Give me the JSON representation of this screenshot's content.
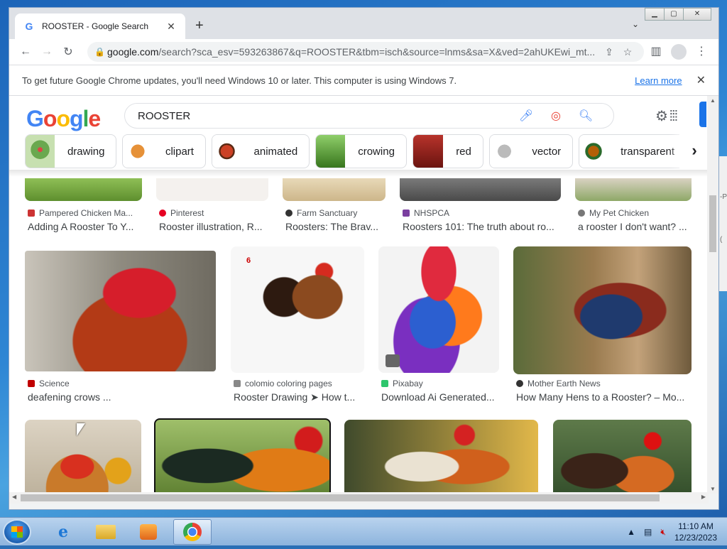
{
  "window": {
    "tab_title": "ROOSTER - Google Search",
    "new_tab": "+",
    "controls": {
      "minimize": "▁",
      "maximize": "▢",
      "close": "✕"
    }
  },
  "toolbar": {
    "url_host": "google.com",
    "url_path": "/search?sca_esv=593263867&q=ROOSTER&tbm=isch&source=lnms&sa=X&ved=2ahUKEwi_mt..."
  },
  "infobar": {
    "message": "To get future Google Chrome updates, you'll need Windows 10 or later. This computer is using Windows 7.",
    "link": "Learn more"
  },
  "google": {
    "logo": [
      "G",
      "o",
      "o",
      "g",
      "l",
      "e"
    ],
    "query": "ROOSTER"
  },
  "chips": [
    {
      "label": "drawing",
      "color": "#6aa84f"
    },
    {
      "label": "clipart",
      "color": "#e69138"
    },
    {
      "label": "animated",
      "color": "#cc4125"
    },
    {
      "label": "crowing",
      "color": "#38761d"
    },
    {
      "label": "red",
      "color": "#990000"
    },
    {
      "label": "vector",
      "color": "#999999"
    },
    {
      "label": "transparent",
      "color": "#b45f06"
    }
  ],
  "results_top": [
    {
      "source": "Pampered Chicken Ma...",
      "title": "Adding A Rooster To Y...",
      "color": "#cc3333"
    },
    {
      "source": "Pinterest",
      "title": "Rooster illustration, R...",
      "color": "#e60023"
    },
    {
      "source": "Farm Sanctuary",
      "title": "Roosters: The Brav...",
      "color": "#333333"
    },
    {
      "source": "NHSPCA",
      "title": "Roosters 101: The truth about ro...",
      "color": "#7b3fa0"
    },
    {
      "source": "My Pet Chicken",
      "title": "a rooster I don't want? ...",
      "color": "#777777"
    }
  ],
  "results_mid": [
    {
      "source": "Science",
      "title": "deafening crows ...",
      "color": "#c00000",
      "badge": ""
    },
    {
      "source": "colomio coloring pages",
      "title": "Rooster Drawing ➤ How t...",
      "color": "#888888",
      "badge": "6"
    },
    {
      "source": "Pixabay",
      "title": "Download Ai Generated...",
      "color": "#2ec66d",
      "badge": ""
    },
    {
      "source": "Mother Earth News",
      "title": "How Many Hens to a Rooster? – Mo...",
      "color": "#333333",
      "badge": ""
    }
  ],
  "taskbar": {
    "time": "11:10 AM",
    "date": "12/23/2023"
  }
}
